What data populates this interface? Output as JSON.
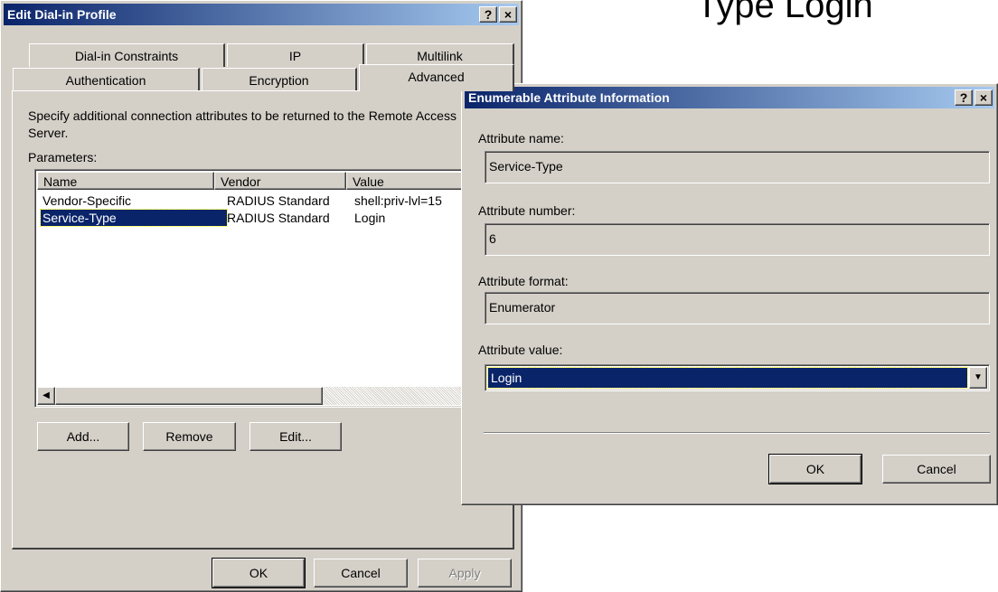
{
  "background_text": "Type    Login",
  "main_dialog": {
    "title": "Edit Dial-in Profile",
    "help_btn": "?",
    "close_btn": "×",
    "tabs_back": [
      "Dial-in Constraints",
      "IP",
      "Multilink"
    ],
    "tabs_front": [
      "Authentication",
      "Encryption",
      "Advanced"
    ],
    "description": "Specify additional connection attributes to be returned to the Remote Access Server.",
    "parameters_label": "Parameters:",
    "columns": [
      "Name",
      "Vendor",
      "Value"
    ],
    "rows": [
      {
        "name": "Vendor-Specific",
        "vendor": "RADIUS Standard",
        "value": "shell:priv-lvl=15"
      },
      {
        "name": "Service-Type",
        "vendor": "RADIUS Standard",
        "value": "Login"
      }
    ],
    "buttons": {
      "add": "Add...",
      "remove": "Remove",
      "edit": "Edit...",
      "ok": "OK",
      "cancel": "Cancel",
      "apply": "Apply"
    }
  },
  "enum_dialog": {
    "title": "Enumerable Attribute Information",
    "help_btn": "?",
    "close_btn": "×",
    "attr_name_label": "Attribute name:",
    "attr_name_value": "Service-Type",
    "attr_number_label": "Attribute number:",
    "attr_number_value": "6",
    "attr_format_label": "Attribute format:",
    "attr_format_value": "Enumerator",
    "attr_value_label": "Attribute value:",
    "attr_value_selected": "Login",
    "ok": "OK",
    "cancel": "Cancel"
  }
}
